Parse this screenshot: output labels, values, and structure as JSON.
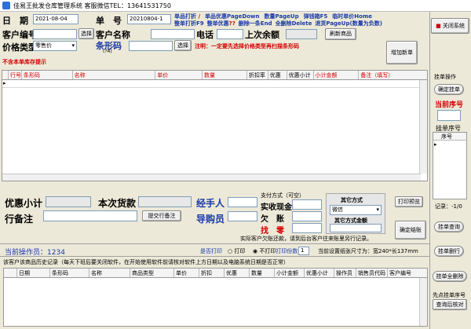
{
  "window": {
    "title": "佳易王批发仓库管理系统 客服微信TEL：13641531750"
  },
  "header": {
    "date_label": "日　期",
    "date_value": "2021-08-04",
    "order_label": "单　号",
    "order_value": "20210804-1",
    "hotkeys_row1": [
      {
        "text": "单品打折",
        "key": "/"
      },
      {
        "text": "单品优惠",
        "key": "PageDown"
      },
      {
        "text": "数量",
        "key": "PageUp"
      },
      {
        "text": "弹钱箱",
        "key": "F5"
      },
      {
        "text": "临时单价",
        "key": "Home"
      }
    ],
    "hotkeys_row2": [
      {
        "text": "整单打折",
        "key": "F9"
      },
      {
        "text": "整单优惠",
        "key": "??"
      },
      {
        "text": "删除一条",
        "key": "End"
      },
      {
        "text": "全删除",
        "key": "Delete"
      },
      {
        "text": "退货",
        "key": "PageUp(数量为负数)"
      }
    ],
    "customer_no_label": "客户编号",
    "select_label": "选择",
    "customer_name_label": "客户名称",
    "phone_label": "电话",
    "last_balance_label": "上次余额",
    "refresh_label": "刷新商品",
    "price_type_label": "价格类型",
    "price_type_value": "零售价",
    "barcode_label": "条形码",
    "barcode_hint": "(?4)",
    "select2_label": "选择",
    "note": "注明：一定要先选择价格类型再扫描条形码",
    "out_of_stock": "不含本单库存提示",
    "add_order_label": "增加新单"
  },
  "grid": {
    "columns": [
      "行号",
      "条形码",
      "名称",
      "单价",
      "数量",
      "折扣率",
      "优惠",
      "优惠小计",
      "小计金额",
      "备注（填写）"
    ],
    "rows": []
  },
  "summary": {
    "discount_subtotal_label": "优惠小计",
    "this_payment_label": "本次货款",
    "handler_label": "经手人",
    "remark_label": "行备注",
    "submit_remark_label": "提交行备注",
    "guide_label": "导购员",
    "pay_method_label": "支付方式（可空）",
    "receivable_label": "实收现金",
    "debt_label": "欠　账",
    "change_label": "找　零",
    "other_method_label": "其它方式",
    "other_method_value": "微信",
    "other_amount_label": "其它方式金额",
    "print_preview_label": "打印预览",
    "settle_label": "确定结账",
    "hint": "实际客户欠账还款，请到后台客户往来账里另行记录。"
  },
  "status": {
    "operator_label": "当前操作员：",
    "operator_value": "1234",
    "print_q_label": "是否打印",
    "print_label": "打印",
    "noprint_label": "不打印",
    "print_copies_label": "打印份数",
    "print_copies_value": "1",
    "paper_label": "当前设置纸张尺寸为：宽240*长137mm"
  },
  "history": {
    "title": "该客户该商品历史记录（每天下班后要关闭软件，在开始使用软件前请核对软件上方日期以及电脑系统日期是否正常）",
    "columns": [
      "日期",
      "条形码",
      "名称",
      "商品类型",
      "单价",
      "折扣",
      "优惠",
      "数量",
      "小计金额",
      "优惠小计",
      "操作员",
      "销售员代码",
      "客户编号"
    ]
  },
  "side": {
    "close_label": "关闭系统",
    "hold_op_label": "挂单操作",
    "confirm_hold_label": "确定挂单",
    "current_no_label": "当前序号",
    "hold_no_label": "挂单序号",
    "seq_header": "序号",
    "record_label": "记录：-1/0",
    "hold_query_label": "挂单查询",
    "hold_delete_label": "挂单删行",
    "hold_all_delete_label": "挂单全删除",
    "first_query_label": "先点挂单序号",
    "query_detail_label": "查询后核对"
  },
  "colors": {
    "accent_blue": "#1a3aa8",
    "accent_red": "#d40000"
  }
}
